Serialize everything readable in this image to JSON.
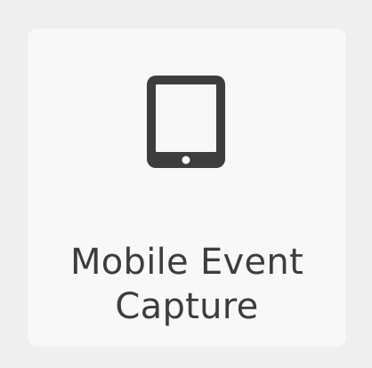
{
  "tile": {
    "label_line1": "Mobile Event",
    "label_line2": "Capture",
    "icon": "tablet-icon"
  },
  "colors": {
    "page_background": "#efefef",
    "tile_background": "#f8f8f8",
    "icon": "#3d3d3d",
    "text": "#3d3d3d"
  }
}
